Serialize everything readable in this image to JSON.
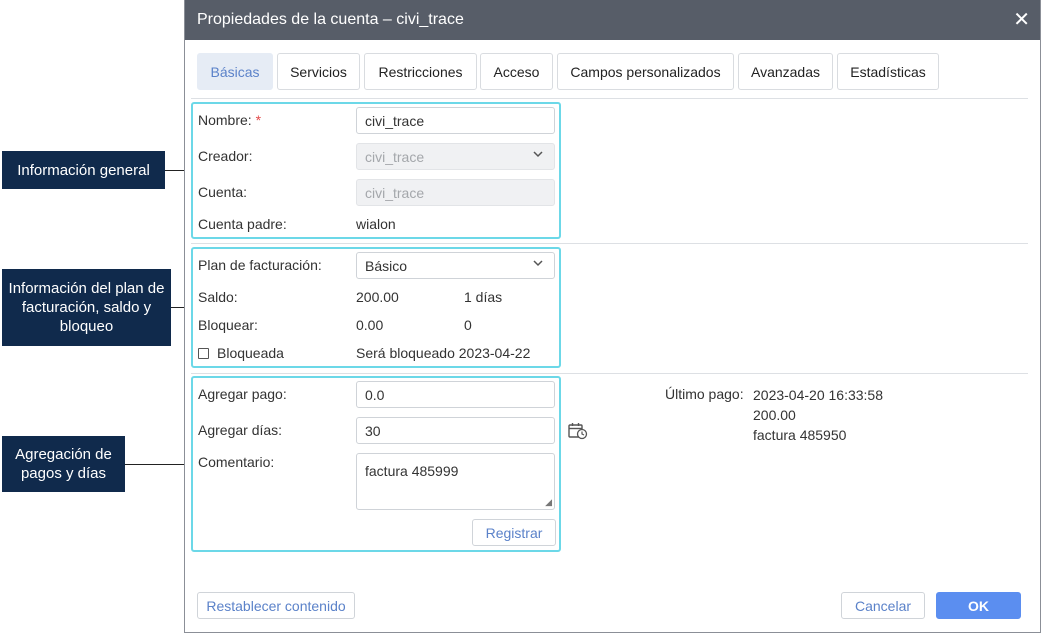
{
  "callouts": {
    "general": "Información general",
    "billing": "Información del plan de facturación, saldo y bloqueo",
    "payments": "Agregación de pagos y días"
  },
  "dialog": {
    "title": "Propiedades de la cuenta – civi_trace",
    "close_glyph": "✕"
  },
  "tabs": [
    {
      "label": "Básicas",
      "active": true
    },
    {
      "label": "Servicios"
    },
    {
      "label": "Restricciones"
    },
    {
      "label": "Acceso"
    },
    {
      "label": "Campos personalizados"
    },
    {
      "label": "Avanzadas"
    },
    {
      "label": "Estadísticas"
    }
  ],
  "general": {
    "name_label": "Nombre:",
    "required_mark": "*",
    "name_value": "civi_trace",
    "creator_label": "Creador:",
    "creator_value": "civi_trace",
    "account_label": "Cuenta:",
    "account_value": "civi_trace",
    "parent_label": "Cuenta padre:",
    "parent_value": "wialon"
  },
  "billing": {
    "plan_label": "Plan de facturación:",
    "plan_value": "Básico",
    "balance_label": "Saldo:",
    "balance_value": "200.00",
    "balance_days": "1 días",
    "block_label": "Bloquear:",
    "block_value": "0.00",
    "block_days": "0",
    "blocked_label": "Bloqueada",
    "blocked_checked": false,
    "blocked_note": "Será bloqueado 2023-04-22"
  },
  "payments": {
    "add_payment_label": "Agregar pago:",
    "add_payment_value": "0.0",
    "add_days_label": "Agregar días:",
    "add_days_value": "30",
    "comment_label": "Comentario:",
    "comment_value": "factura 485999",
    "register_button": "Registrar",
    "calendar_icon": "calendar-clock-icon"
  },
  "last_payment": {
    "label": "Último pago:",
    "datetime": "2023-04-20 16:33:58",
    "amount": "200.00",
    "comment": "factura 485950"
  },
  "footer": {
    "reset_button": "Restablecer contenido",
    "cancel_button": "Cancelar",
    "ok_button": "OK"
  },
  "colors": {
    "titlebar": "#575d68",
    "callout_bg": "#102a4c",
    "highlight_border": "#6cd8e8",
    "accent": "#5b82c9",
    "primary_button": "#5b8ef0"
  }
}
